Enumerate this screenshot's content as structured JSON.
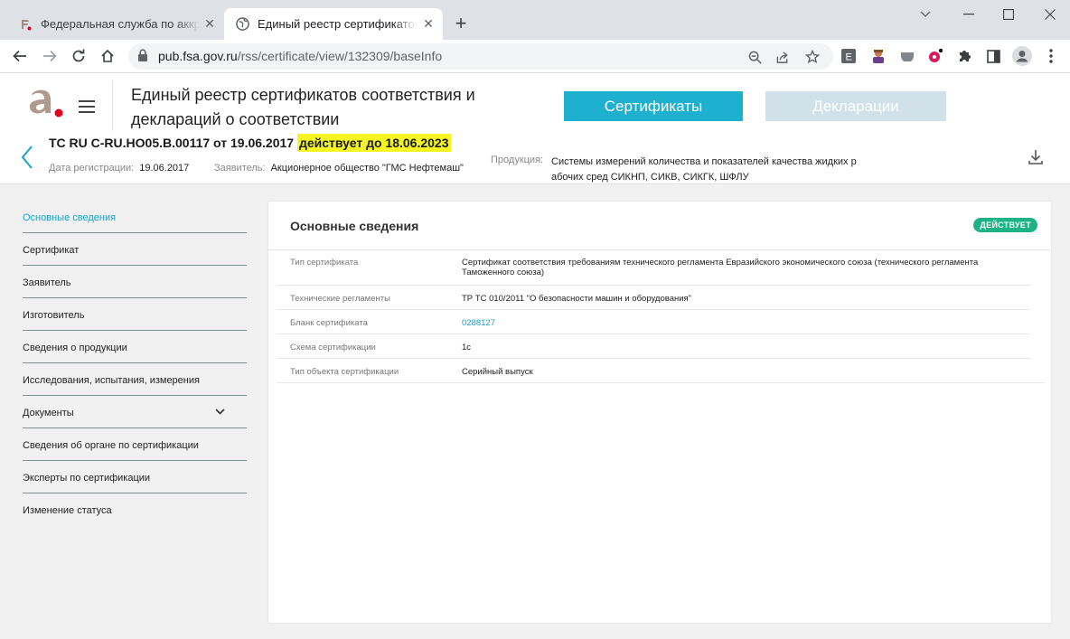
{
  "browser": {
    "tabs": [
      {
        "title": "Федеральная служба по аккредитации",
        "icon": "fsa-favicon",
        "active": false
      },
      {
        "title": "Единый реестр сертификатов соответствия",
        "icon": "globe-icon",
        "active": true
      }
    ],
    "new_tab_label": "+",
    "address": {
      "host": "pub.fsa.gov.ru",
      "path": "/rss/certificate/view/132309/baseInfo"
    },
    "toolbar_icons": [
      "back-icon",
      "forward-icon",
      "reload-icon",
      "home-icon",
      "zoom-icon",
      "share-icon",
      "star-icon",
      "extension-e-icon",
      "extension-avatar-icon",
      "extension-grey-icon",
      "extension-pink-icon",
      "extensions-puzzle-icon",
      "side-panel-icon",
      "profile-icon",
      "menu-kebab-icon"
    ]
  },
  "header": {
    "title": "Единый реестр сертификатов соответствия и деклараций о соответствии",
    "nav": {
      "certificates": "Сертификаты",
      "declarations": "Декларации"
    }
  },
  "record": {
    "number": "ТС RU С-RU.НО05.В.00117 от 19.06.2017",
    "status_highlight": "действует до 18.06.2023",
    "reg_date_label": "Дата регистрации:",
    "reg_date": "19.06.2017",
    "applicant_label": "Заявитель:",
    "applicant": "Акционерное общество \"ГМС Нефтемаш\"",
    "product_label": "Продукция:",
    "product": "Системы измерений количества и показателей качества жидких р абочих сред СИКНП, СИКВ, СИКГК, ШФЛУ"
  },
  "sidebar": {
    "items": [
      {
        "label": "Основные сведения",
        "active": true
      },
      {
        "label": "Сертификат"
      },
      {
        "label": "Заявитель"
      },
      {
        "label": "Изготовитель"
      },
      {
        "label": "Сведения о продукции"
      },
      {
        "label": "Исследования, испытания, измерения"
      },
      {
        "label": "Документы",
        "expandable": true
      },
      {
        "label": "Сведения об органе по сертификации"
      },
      {
        "label": "Эксперты по сертификации"
      },
      {
        "label": "Изменение статуса"
      }
    ]
  },
  "card": {
    "title": "Основные сведения",
    "badge": "ДЕЙСТВУЕТ",
    "badge_color": "#1db387",
    "rows": [
      {
        "key": "Тип сертификата",
        "value": "Сертификат соответствия требованиям технического регламента Евразийского экономического союза (технического регламента Таможенного союза)"
      },
      {
        "key": "Технические регламенты",
        "value": "ТР ТС 010/2011 \"О безопасности машин и оборудования\""
      },
      {
        "key": "Бланк сертификата",
        "value": "0288127"
      },
      {
        "key": "Схема сертификации",
        "value": "1с"
      },
      {
        "key": "Тип объекта сертификации",
        "value": "Серийный выпуск"
      }
    ]
  },
  "colors": {
    "accent": "#1eb1cf",
    "link": "#1a9cc0",
    "highlight": "#f5f524",
    "inactive_nav": "#d0e1ea"
  }
}
